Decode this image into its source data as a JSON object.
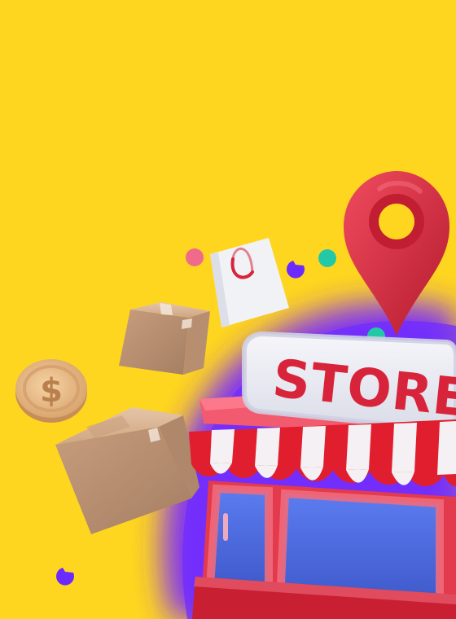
{
  "colors": {
    "background": "#FFD61F",
    "purple_blob": "#7A2BFF",
    "store_red": "#D8243A",
    "awning_white": "#F5F0F3",
    "window_blue": "#4D6BE0",
    "pin_red": "#D7263D",
    "coin_gold": "#E6B57A",
    "box_tan": "#D6B08F",
    "bag_white": "#F1F2F6",
    "dot_pink": "#F06A8B",
    "dot_teal": "#23C9A7",
    "dot_purple": "#6B2BFF"
  },
  "sign": {
    "text": "STORE"
  },
  "coin": {
    "symbol": "$"
  },
  "icons": [
    "location-pin-icon",
    "shopping-bag-icon",
    "package-box-icon",
    "dollar-coin-icon",
    "storefront-icon"
  ]
}
